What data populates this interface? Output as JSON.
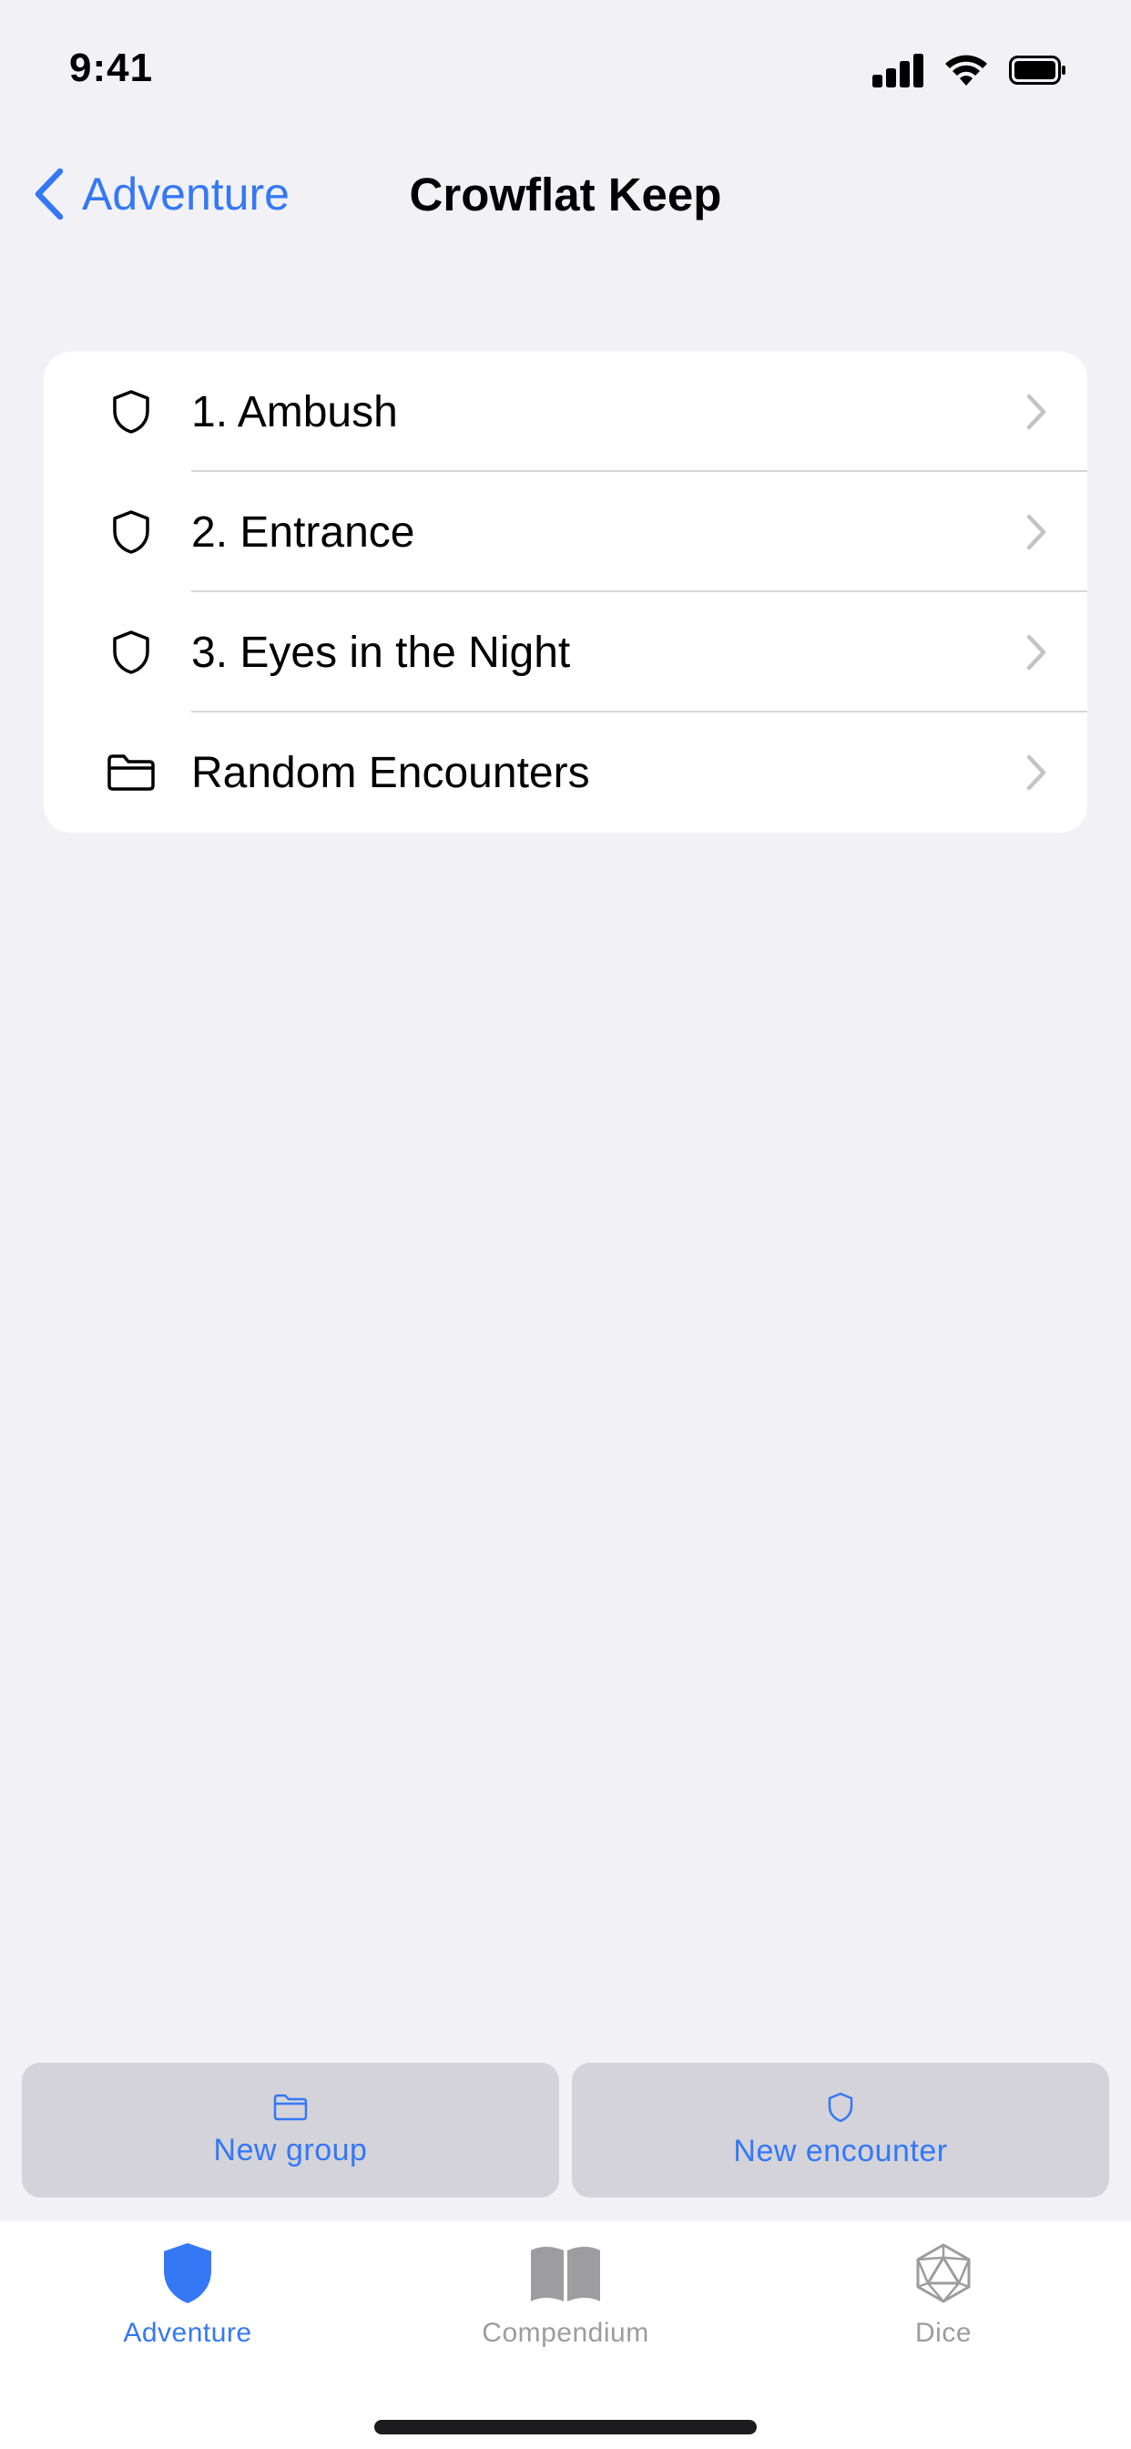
{
  "status_bar": {
    "time": "9:41"
  },
  "nav": {
    "back_label": "Adventure",
    "title": "Crowflat Keep"
  },
  "list": {
    "items": [
      {
        "label": "1. Ambush",
        "icon": "shield-icon"
      },
      {
        "label": "2. Entrance",
        "icon": "shield-icon"
      },
      {
        "label": "3. Eyes in the Night",
        "icon": "shield-icon"
      },
      {
        "label": "Random Encounters",
        "icon": "folder-icon"
      }
    ]
  },
  "actions": {
    "new_group_label": "New group",
    "new_encounter_label": "New encounter"
  },
  "tab_bar": {
    "tabs": [
      {
        "label": "Adventure",
        "icon": "shield-filled-icon",
        "active": true
      },
      {
        "label": "Compendium",
        "icon": "book-icon",
        "active": false
      },
      {
        "label": "Dice",
        "icon": "d20-icon",
        "active": false
      }
    ]
  },
  "colors": {
    "accent": "#3478f6",
    "background": "#f2f1f6",
    "inactive_tab": "#9c9ca1"
  }
}
